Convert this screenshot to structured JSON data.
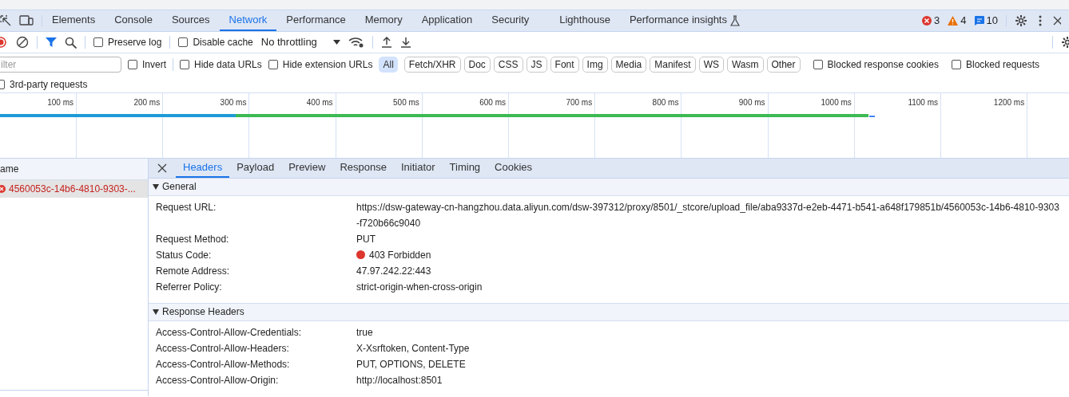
{
  "devtools": {
    "tabs": [
      {
        "label": "Elements",
        "selected": false
      },
      {
        "label": "Console",
        "selected": false
      },
      {
        "label": "Sources",
        "selected": false
      },
      {
        "label": "Network",
        "selected": true
      },
      {
        "label": "Performance",
        "selected": false
      },
      {
        "label": "Memory",
        "selected": false
      },
      {
        "label": "Application",
        "selected": false
      },
      {
        "label": "Security",
        "selected": false
      },
      {
        "label": "Lighthouse",
        "selected": false
      },
      {
        "label": "Performance insights",
        "selected": false
      }
    ],
    "counts": {
      "errors": "3",
      "warnings": "4",
      "messages": "10"
    }
  },
  "toolbar": {
    "recording": true,
    "preserve_log": {
      "label": "Preserve log",
      "checked": false
    },
    "disable_cache": {
      "label": "Disable cache",
      "checked": false
    },
    "throttling": "No throttling"
  },
  "filter_bar": {
    "placeholder": "ilter",
    "invert": {
      "label": "Invert",
      "checked": false
    },
    "options": [
      {
        "label": "Hide data URLs",
        "checked": false
      },
      {
        "label": "Hide extension URLs",
        "checked": false
      }
    ],
    "types": [
      {
        "label": "All",
        "selected": true
      },
      {
        "label": "Fetch/XHR",
        "selected": false
      },
      {
        "label": "Doc",
        "selected": false
      },
      {
        "label": "CSS",
        "selected": false
      },
      {
        "label": "JS",
        "selected": false
      },
      {
        "label": "Font",
        "selected": false
      },
      {
        "label": "Img",
        "selected": false
      },
      {
        "label": "Media",
        "selected": false
      },
      {
        "label": "Manifest",
        "selected": false
      },
      {
        "label": "WS",
        "selected": false
      },
      {
        "label": "Wasm",
        "selected": false
      },
      {
        "label": "Other",
        "selected": false
      }
    ],
    "blocked": [
      {
        "label": "Blocked response cookies",
        "checked": false
      },
      {
        "label": "Blocked requests",
        "checked": false
      }
    ],
    "third_party": {
      "label": "3rd-party requests",
      "checked": false
    }
  },
  "timeline": {
    "ticks": [
      "100 ms",
      "200 ms",
      "300 ms",
      "400 ms",
      "500 ms",
      "600 ms",
      "700 ms",
      "800 ms",
      "900 ms",
      "1000 ms",
      "1100 ms",
      "1200 ms"
    ]
  },
  "requests": {
    "column": "ame",
    "rows": [
      {
        "name": "4560053c-14b6-4810-9303-...",
        "selected": true,
        "failed": true
      }
    ]
  },
  "details": {
    "tabs": [
      {
        "label": "Headers",
        "selected": true
      },
      {
        "label": "Payload",
        "selected": false
      },
      {
        "label": "Preview",
        "selected": false
      },
      {
        "label": "Response",
        "selected": false
      },
      {
        "label": "Initiator",
        "selected": false
      },
      {
        "label": "Timing",
        "selected": false
      },
      {
        "label": "Cookies",
        "selected": false
      }
    ],
    "sections": [
      {
        "title": "General",
        "expanded": true,
        "rows": [
          {
            "name": "Request URL:",
            "value": "https://dsw-gateway-cn-hangzhou.data.aliyun.com/dsw-397312/proxy/8501/_stcore/upload_file/aba9337d-e2eb-4471-b541-a648f179851b/4560053c-14b6-4810-9303-f720b66c9040"
          },
          {
            "name": "Request Method:",
            "value": "PUT"
          },
          {
            "name": "Status Code:",
            "value": "403 Forbidden",
            "kind": "status"
          },
          {
            "name": "Remote Address:",
            "value": "47.97.242.22:443"
          },
          {
            "name": "Referrer Policy:",
            "value": "strict-origin-when-cross-origin"
          }
        ]
      },
      {
        "title": "Response Headers",
        "expanded": true,
        "rows": [
          {
            "name": "Access-Control-Allow-Credentials:",
            "value": "true"
          },
          {
            "name": "Access-Control-Allow-Headers:",
            "value": "X-Xsrftoken, Content-Type"
          },
          {
            "name": "Access-Control-Allow-Methods:",
            "value": "PUT, OPTIONS, DELETE"
          },
          {
            "name": "Access-Control-Allow-Origin:",
            "value": "http://localhost:8501"
          }
        ]
      }
    ]
  }
}
